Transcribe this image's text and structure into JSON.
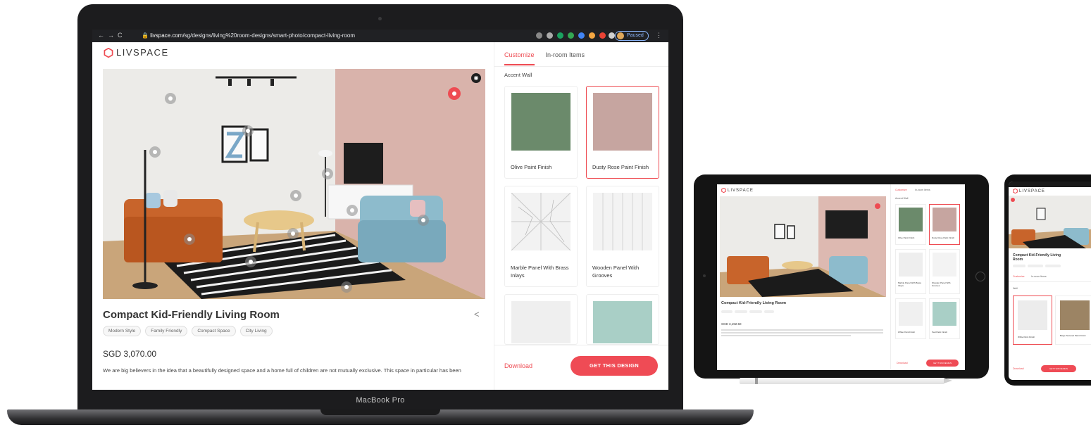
{
  "laptop": {
    "device_label": "MacBook Pro",
    "browser": {
      "url_prefix": "livspace.com",
      "url_rest": "/sg/designs/living%20room-designs/smart-photo/compact-living-room",
      "profile_status": "Paused"
    },
    "brand": "LIVSPACE",
    "project": {
      "title": "Compact Kid-Friendly Living Room",
      "tags": [
        "Modern Style",
        "Family Friendly",
        "Compact Space",
        "City Living"
      ],
      "price": "SGD 3,070.00",
      "description": "We are big believers in the idea that a beautifully designed space and a home full of children are not mutually exclusive. This space in particular has been"
    },
    "panel": {
      "tabs": [
        "Customize",
        "In-room Items"
      ],
      "section": "Accent Wall",
      "cards": [
        {
          "name": "Olive Paint Finish",
          "color": "#6b8a6b"
        },
        {
          "name": "Dusty Rose Paint Finish",
          "color": "#c6a5a0"
        },
        {
          "name": "Marble Panel With Brass Inlays",
          "color": "#ededed"
        },
        {
          "name": "Wooden Panel With Grooves",
          "color": "#f1f1f1"
        }
      ],
      "download_label": "Download",
      "cta_label": "GET THIS DESIGN"
    }
  },
  "tablet": {
    "brand": "LIVSPACE",
    "tabs": [
      "Customize",
      "In-room Items"
    ],
    "section": "Accent Wall",
    "title": "Compact Kid-Friendly Living Room",
    "price": "SGD 3,192.50",
    "cards": [
      "Olive Paint Finish",
      "Dusty Rose Paint Finish",
      "Marble Panel With Brass Inlays",
      "Wooden Panel With Grooves",
      "White Paint Finish",
      "Teal Paint Finish"
    ],
    "download_label": "Download",
    "cta_label": "GET THIS DESIGN"
  },
  "phone": {
    "brand": "LIVSPACE",
    "title": "Compact Kid-Friendly Living Room",
    "tabs": [
      "Customize",
      "In-room Items"
    ],
    "section": "Wall",
    "cards": [
      "White Paint Finish",
      "Beige Textured Paint Finish"
    ],
    "download_label": "Download",
    "cta_label": "GET THIS DESIGN"
  },
  "colors": {
    "accent": "#ee4b52",
    "device_body": "#1c1c1e"
  }
}
